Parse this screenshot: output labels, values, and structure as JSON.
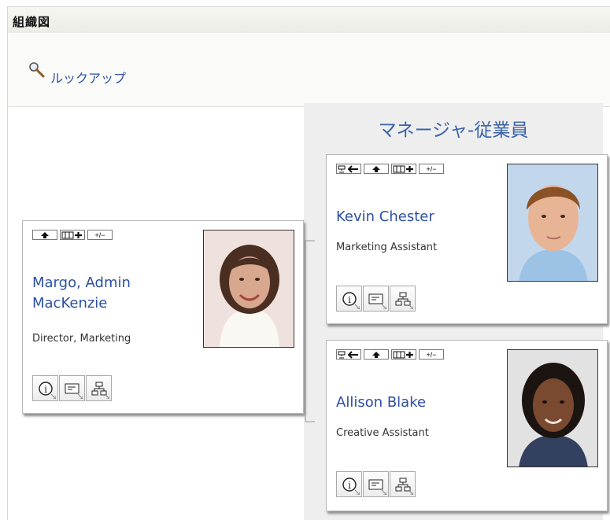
{
  "page": {
    "title": "組織図"
  },
  "lookup": {
    "label": "ルックアップ",
    "icon": "magnifier-icon"
  },
  "group": {
    "title": "マネージャ-従業員"
  },
  "colors": {
    "link": "#2d4fa3",
    "group_title": "#3a63a8",
    "gutter": "#eeeeee"
  },
  "toolbar_labels": {
    "expand_collapse": "+/−"
  },
  "manager": {
    "name": "Margo, Admin MacKenzie",
    "title": "Director, Marketing",
    "toolbar": [
      "go-up-icon",
      "show-reports-icon",
      "expand-collapse-button"
    ],
    "actions": [
      "info-icon",
      "email-icon",
      "org-chart-icon"
    ]
  },
  "employees": [
    {
      "name": "Kevin Chester",
      "title": "Marketing Assistant",
      "toolbar": [
        "set-root-icon",
        "go-up-icon",
        "show-reports-icon",
        "expand-collapse-button"
      ],
      "actions": [
        "info-icon",
        "email-icon",
        "org-chart-icon"
      ]
    },
    {
      "name": "Allison Blake",
      "title": "Creative Assistant",
      "toolbar": [
        "set-root-icon",
        "go-up-icon",
        "show-reports-icon",
        "expand-collapse-button"
      ],
      "actions": [
        "info-icon",
        "email-icon",
        "org-chart-icon"
      ]
    }
  ]
}
